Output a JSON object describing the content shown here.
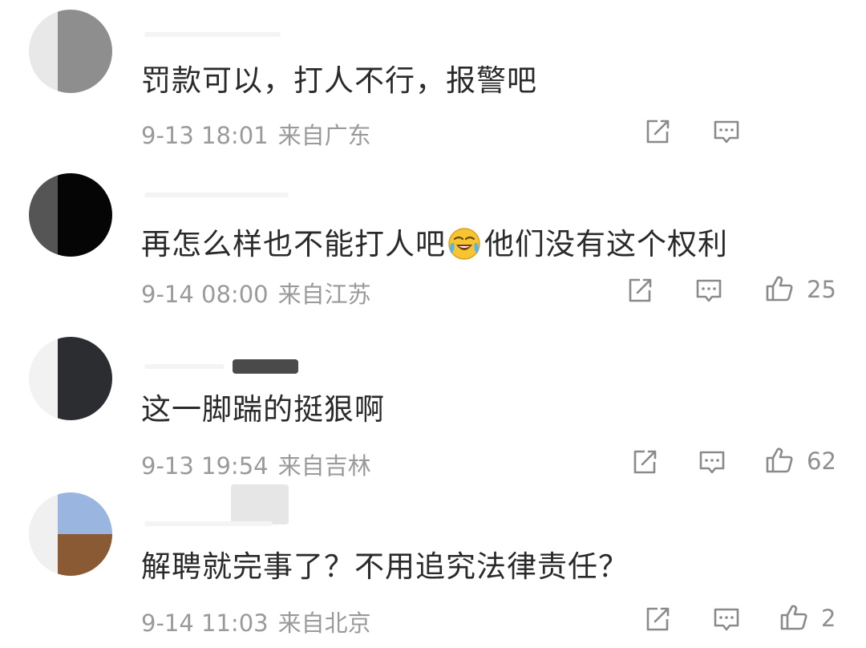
{
  "comments": [
    {
      "text": "罚款可以，打人不行，报警吧",
      "date": "9-13 18:01",
      "location": "来自广东",
      "likes": null
    },
    {
      "text_before": "再怎么样也不能打人吧",
      "emoji": "crying-laughing-emoji",
      "text_after": "他们没有这个权利",
      "date": "9-14 08:00",
      "location": "来自江苏",
      "likes": "25"
    },
    {
      "text": "这一脚踹的挺狠啊",
      "date": "9-13 19:54",
      "location": "来自吉林",
      "likes": "62"
    },
    {
      "text": "解聘就完事了？不用追究法律责任？",
      "date": "9-14 11:03",
      "location": "来自北京",
      "likes": "2"
    }
  ],
  "icons": {
    "share": "share-icon",
    "comment": "comment-icon",
    "like": "thumbs-up-icon"
  },
  "colors": {
    "text": "#2a2a2a",
    "meta": "#9a9a9a",
    "icon": "#8a8a8a"
  }
}
